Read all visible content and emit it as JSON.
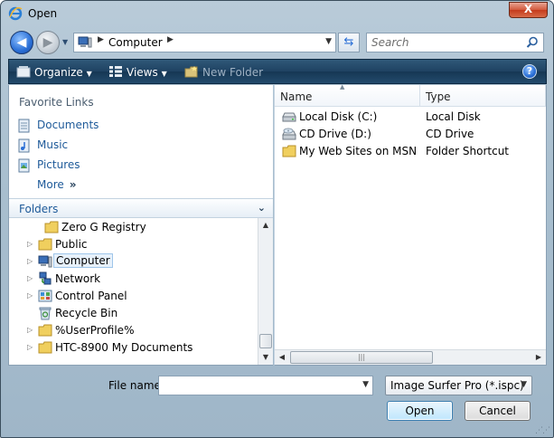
{
  "window": {
    "title": "Open",
    "close_label": "X"
  },
  "address": {
    "segments": [
      "Computer"
    ],
    "icon": "computer-icon"
  },
  "search": {
    "placeholder": "Search"
  },
  "toolbar": {
    "organize_label": "Organize",
    "views_label": "Views",
    "new_folder_label": "New Folder"
  },
  "favorites": {
    "header": "Favorite Links",
    "items": [
      {
        "label": "Documents",
        "icon": "documents-icon"
      },
      {
        "label": "Music",
        "icon": "music-icon"
      },
      {
        "label": "Pictures",
        "icon": "pictures-icon"
      },
      {
        "label": "More",
        "icon": "double-chevron-icon"
      }
    ]
  },
  "folders": {
    "label": "Folders",
    "items": [
      {
        "label": "Zero G Registry",
        "icon": "folder-icon",
        "expandable": false
      },
      {
        "label": "Public",
        "icon": "folder-icon",
        "expandable": true
      },
      {
        "label": "Computer",
        "icon": "computer-icon",
        "expandable": true,
        "selected": true
      },
      {
        "label": "Network",
        "icon": "network-icon",
        "expandable": true
      },
      {
        "label": "Control Panel",
        "icon": "control-panel-icon",
        "expandable": true
      },
      {
        "label": "Recycle Bin",
        "icon": "recycle-bin-icon",
        "expandable": false
      },
      {
        "label": "%UserProfile%",
        "icon": "folder-icon",
        "expandable": true
      },
      {
        "label": "HTC-8900 My Documents",
        "icon": "folder-icon",
        "expandable": true
      }
    ]
  },
  "file_list": {
    "columns": [
      "Name",
      "Type"
    ],
    "rows": [
      {
        "name": "Local Disk (C:)",
        "type": "Local Disk",
        "icon": "hard-disk-icon"
      },
      {
        "name": "CD Drive (D:)",
        "type": "CD Drive",
        "icon": "cd-drive-icon"
      },
      {
        "name": "My Web Sites on MSN",
        "type": "Folder Shortcut",
        "icon": "folder-shortcut-icon"
      }
    ]
  },
  "bottom": {
    "filename_label": "File name:",
    "filename_value": "",
    "filetype_selected": "Image Surfer Pro (*.ispc)",
    "open_label": "Open",
    "cancel_label": "Cancel"
  },
  "colors": {
    "accent": "#1e5a99",
    "toolbar": "#1f4262",
    "selection": "#e7f1fb"
  }
}
